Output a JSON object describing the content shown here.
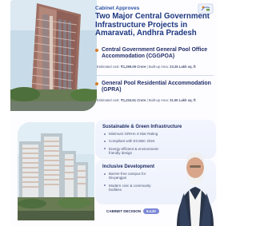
{
  "header": {
    "eyebrow": "Cabinet Approves",
    "title": "Two Major Central Government Infrastructure Projects in Amaravati, Andhra Pradesh"
  },
  "projects": [
    {
      "name": "Central Government General Pool Office Accommodation (CGGPOA)",
      "estimate_label": "Estimated cost:",
      "estimate_value": "₹1,299.09 Crore",
      "area_label": "Built-up Area:",
      "area_value": "23.25 Lakh sq. ft"
    },
    {
      "name": "General Pool Residential Accommodation (GPRA)",
      "estimate_label": "Estimated cost:",
      "estimate_value": "₹1,234.61 Crore",
      "area_label": "Built-up Area:",
      "area_value": "31.50 Lakh sq. ft"
    }
  ],
  "panels": [
    {
      "title": "Sustainable & Green Infrastructure",
      "items": [
        "Minimum GRIHA 4-Star Rating",
        "Compliant with ECSBC 2024",
        "Energy-efficient & environment-friendly design"
      ]
    },
    {
      "title": "Inclusive Development",
      "items": [
        "Barrier-free campus for Divyangjan",
        "Modern civic & community facilities"
      ]
    }
  ],
  "footer": {
    "label": "CABINET DECISION",
    "badge": "9.4.20"
  },
  "icons": {
    "logo": "government-logo-icon",
    "bullet": "orange-bullet-icon",
    "list_bullet": "gray-bullet-icon"
  },
  "colors": {
    "title_blue": "#1d3880",
    "eyebrow_blue": "#2f56a6",
    "accent_orange": "#d77d2c",
    "panel_bg": "#edf1fb",
    "badge": "#7b87d6"
  }
}
